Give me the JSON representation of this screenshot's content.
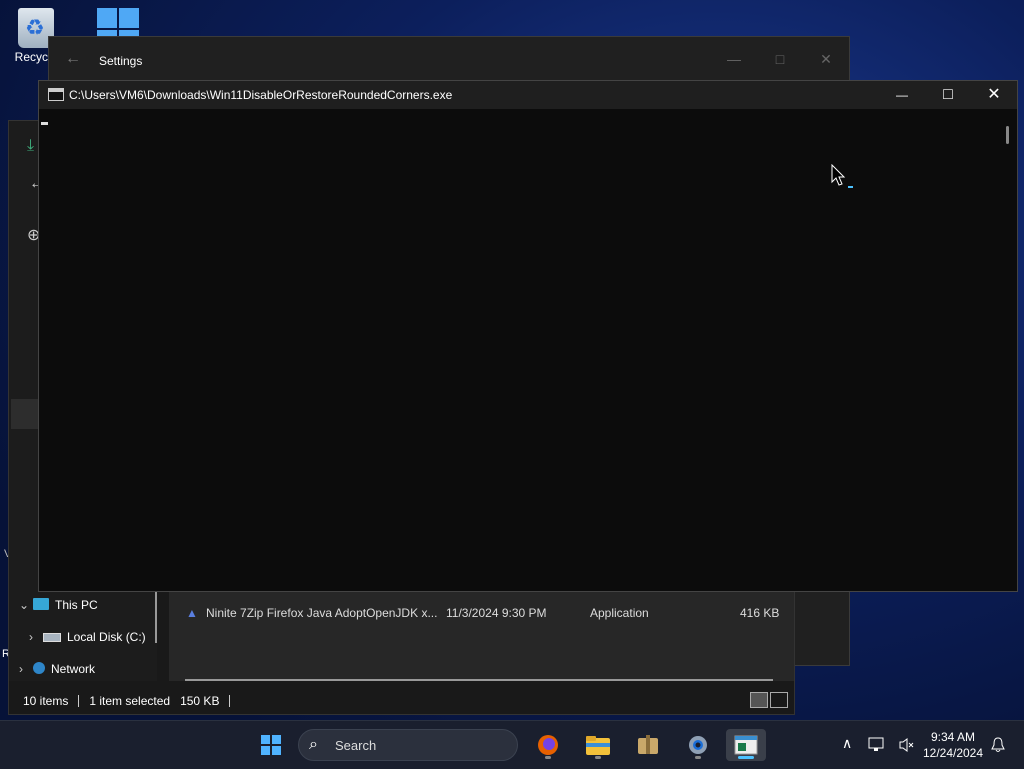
{
  "desktop": {
    "recycle_label": "Recycle",
    "left_edge_r": "R",
    "left_edge_v": "V"
  },
  "settings_window": {
    "title": "Settings",
    "back_glyph": "←",
    "minimize_glyph": "—",
    "maximize_glyph": "□",
    "close_glyph": "✕"
  },
  "console_window": {
    "title": "C:\\Users\\VM6\\Downloads\\Win11DisableOrRestoreRoundedCorners.exe",
    "minimize_glyph": "—",
    "maximize_glyph": "□",
    "close_glyph": "✕"
  },
  "explorer": {
    "tree": [
      {
        "chev": "⌄",
        "label": "This PC"
      },
      {
        "chev": "›",
        "label": "Local Disk (C:)"
      },
      {
        "chev": "›",
        "label": "Network"
      }
    ],
    "file_row": {
      "name": "Ninite 7Zip Firefox Java AdoptOpenJDK x...",
      "date": "11/3/2024 9:30 PM",
      "type": "Application",
      "size": "416 KB"
    },
    "status": {
      "items": "10 items",
      "selected": "1 item selected",
      "size": "150 KB"
    }
  },
  "taskbar": {
    "search_placeholder": "Search",
    "search_glyph": "⌕",
    "apps": [
      "start",
      "firefox",
      "file-explorer",
      "archive",
      "settings",
      "terminal"
    ],
    "tray": {
      "chevron": "∧",
      "time": "9:34 AM",
      "date": "12/24/2024"
    }
  },
  "colors": {
    "accent": "#4cc2ff",
    "console_bg": "#0c0c0c",
    "taskbar_bg": "#1a1f2e"
  }
}
